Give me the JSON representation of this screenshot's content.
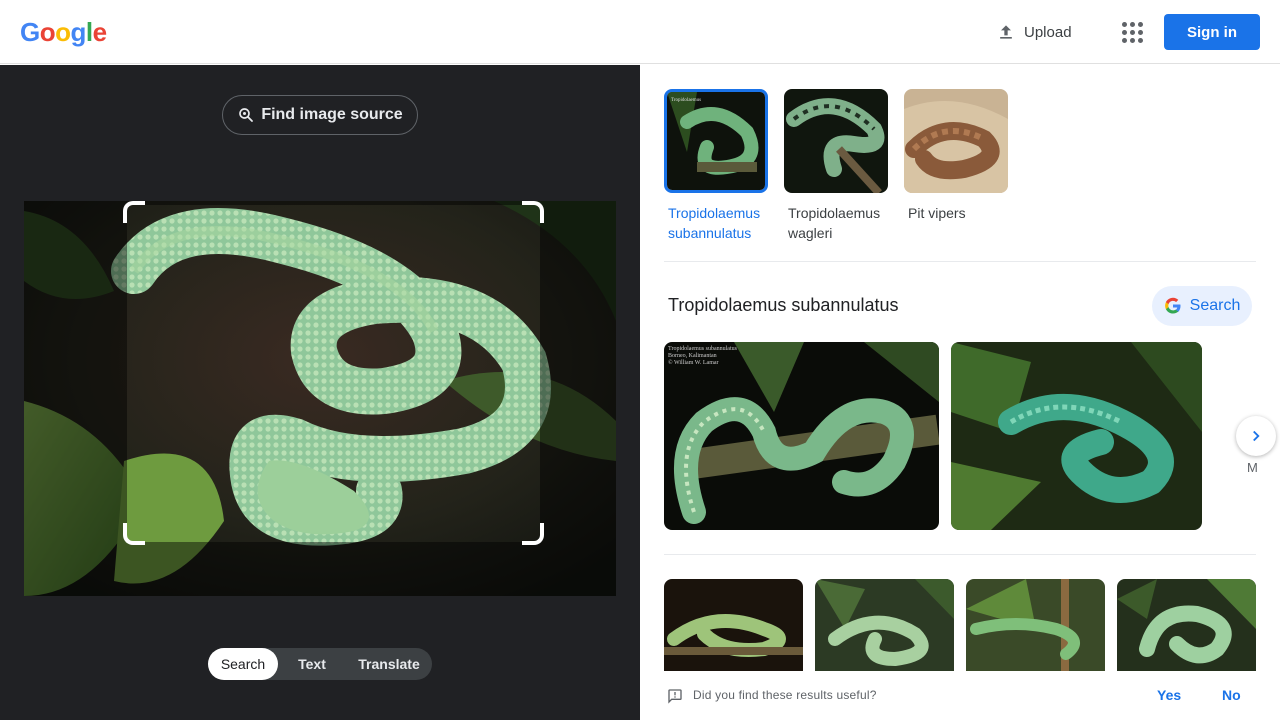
{
  "header": {
    "logo": [
      "G",
      "o",
      "o",
      "g",
      "l",
      "e"
    ],
    "upload_label": "Upload",
    "sign_in_label": "Sign in"
  },
  "left_panel": {
    "find_source_label": "Find image source",
    "tabs": [
      {
        "label": "Search",
        "active": true
      },
      {
        "label": "Text",
        "active": false
      },
      {
        "label": "Translate",
        "active": false
      }
    ]
  },
  "right_panel": {
    "chips": [
      {
        "label": "Tropidolaemus subannulatus",
        "active": true
      },
      {
        "label": "Tropidolaemus wagleri",
        "active": false
      },
      {
        "label": "Pit vipers",
        "active": false
      }
    ],
    "section_title": "Tropidolaemus subannulatus",
    "search_button_label": "Search",
    "result_caption": [
      "Tropidolaemus subannulatus",
      "Borneo, Kalimantan",
      "© William W. Lamar"
    ],
    "more_hint": "M",
    "feedback": {
      "question": "Did you find these results useful?",
      "yes": "Yes",
      "no": "No"
    }
  },
  "colors": {
    "accent": "#1a73e8",
    "left_bg": "#202124",
    "snake_green": "#7fbf8a"
  },
  "icons": [
    "upload-icon",
    "apps-grid-icon",
    "lens-search-icon",
    "google-g-icon",
    "chevron-right-icon",
    "feedback-icon"
  ]
}
